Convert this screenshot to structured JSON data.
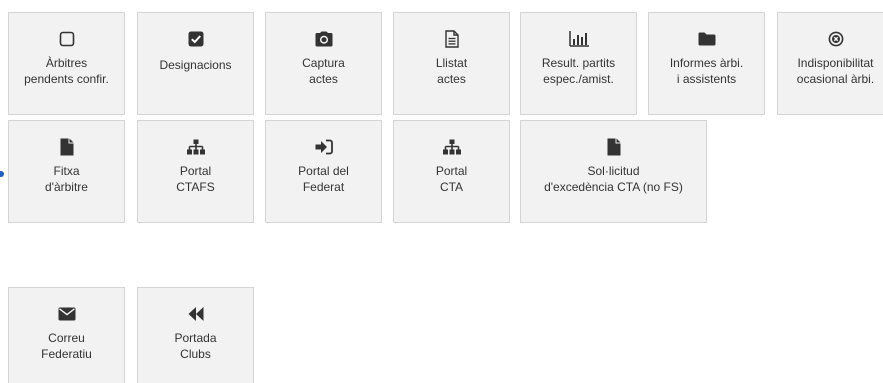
{
  "tiles": [
    {
      "label": "Àrbitres\npendents confir.",
      "icon": "square-outline-icon"
    },
    {
      "label": "Designacions",
      "icon": "checkbox-checked-icon"
    },
    {
      "label": "Captura\nactes",
      "icon": "camera-icon"
    },
    {
      "label": "Llistat\nactes",
      "icon": "document-lines-icon"
    },
    {
      "label": "Result. partits\nespec./amist.",
      "icon": "bar-chart-icon"
    },
    {
      "label": "Informes àrbi.\ni assistents",
      "icon": "folder-icon"
    },
    {
      "label": "Indisponibilitat\nocasional àrbi.",
      "icon": "circle-times-icon"
    },
    {
      "label": "Fitxa\nd'àrbitre",
      "icon": "file-icon"
    },
    {
      "label": "Portal\nCTAFS",
      "icon": "sitemap-icon"
    },
    {
      "label": "Portal del\nFederat",
      "icon": "sign-in-icon"
    },
    {
      "label": "Portal\nCTA",
      "icon": "sitemap-icon"
    },
    {
      "label": "Sol·licitud\nd'excedència CTA (no FS)",
      "icon": "file-icon"
    },
    {
      "label": "Correu\nFederatiu",
      "icon": "envelope-icon"
    },
    {
      "label": "Portada\nClubs",
      "icon": "backward-icon"
    }
  ],
  "colors": {
    "tile_bg": "#f2f2f2",
    "tile_border": "#d4d4d4",
    "icon": "#333333",
    "text": "#333333",
    "pointer": "#1f5fbf"
  }
}
